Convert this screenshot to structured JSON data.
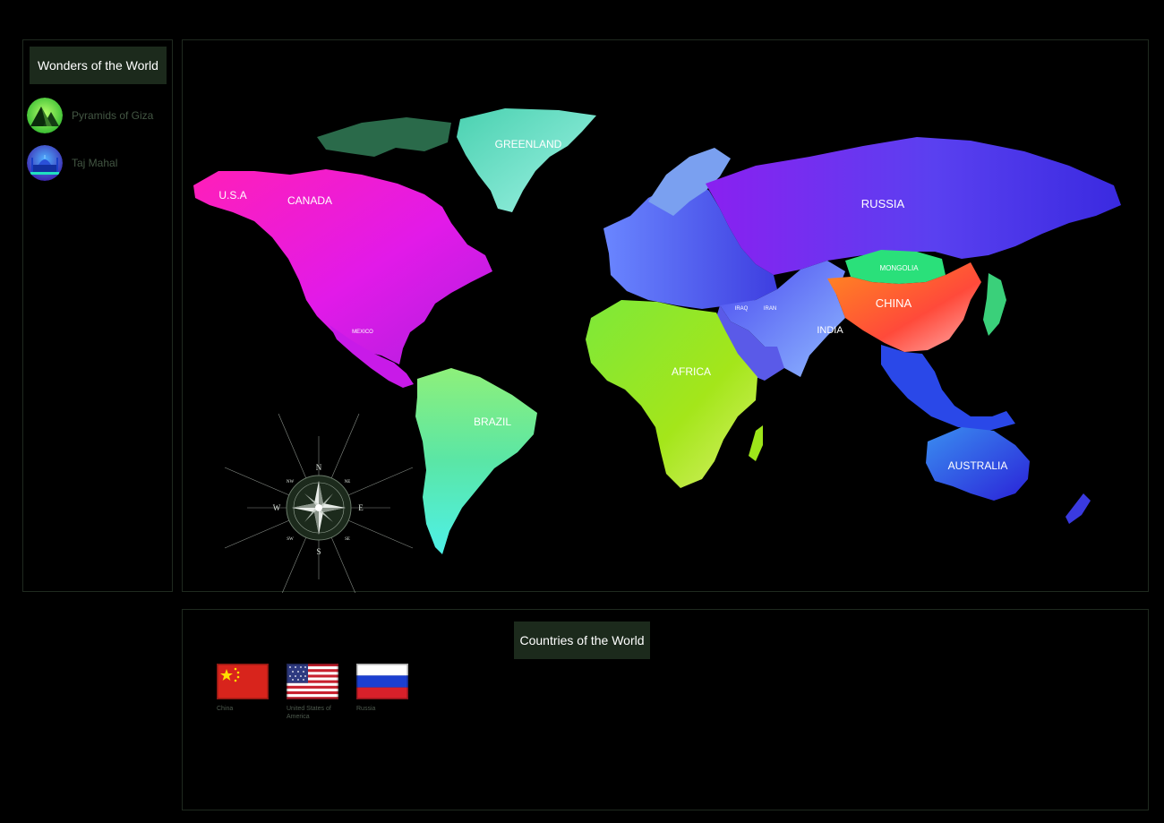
{
  "wonders": {
    "title": "Wonders of the World",
    "items": [
      {
        "label": "Pyramids of Giza",
        "icon": "pyramid-icon"
      },
      {
        "label": "Taj Mahal",
        "icon": "taj-mahal-icon"
      }
    ]
  },
  "map": {
    "labels": {
      "usa": "U.S.A",
      "canada": "CANADA",
      "greenland": "GREENLAND",
      "russia": "RUSSIA",
      "mongolia": "MONGOLIA",
      "china": "CHINA",
      "iraq": "IRAQ",
      "iran": "IRAN",
      "india": "INDIA",
      "mexico": "MEXICO",
      "africa": "AFRICA",
      "brazil": "BRAZIL",
      "australia": "AUSTRALIA"
    },
    "compass": {
      "n": "N",
      "s": "S",
      "e": "E",
      "w": "W",
      "ne": "NE",
      "nw": "NW",
      "se": "SE",
      "sw": "SW"
    },
    "colors": {
      "north_america": "#ff1fd2",
      "greenland": "#7fe0c8",
      "south_america": "#5be6a6",
      "africa": "#9be31f",
      "europe": "#5a6cf0",
      "russia": "#7a2cf0",
      "china": "#ff7a2e",
      "mongolia": "#26e07a",
      "australia": "#2a36e6"
    }
  },
  "countries": {
    "title": "Countries of the World",
    "items": [
      {
        "label": "China",
        "icon": "china-flag-icon"
      },
      {
        "label": "United States of America",
        "icon": "usa-flag-icon"
      },
      {
        "label": "Russia",
        "icon": "russia-flag-icon"
      }
    ]
  }
}
